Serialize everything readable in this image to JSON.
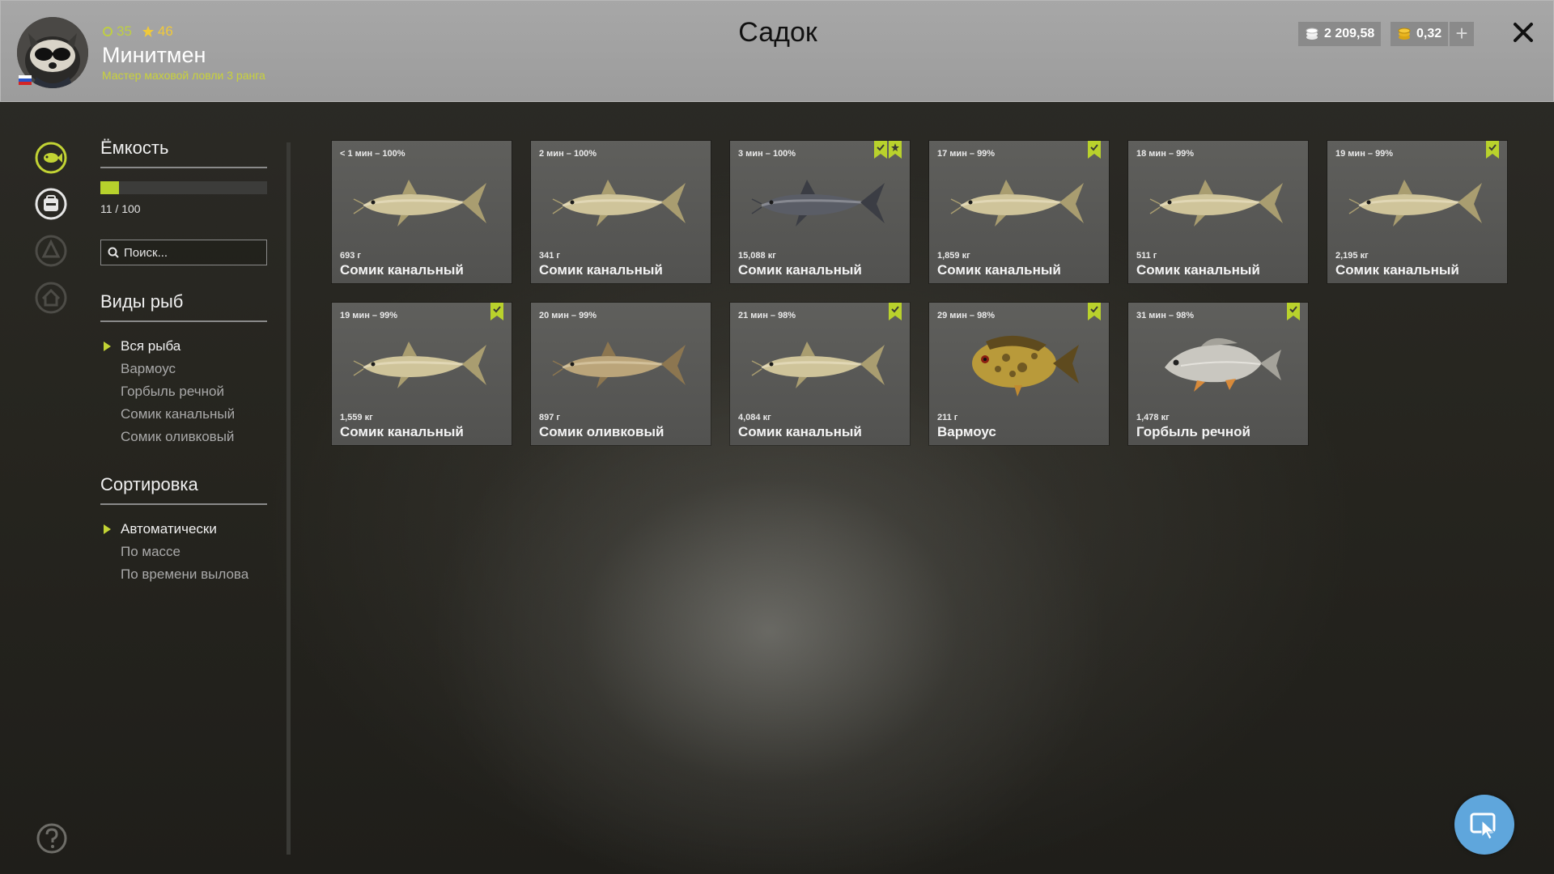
{
  "header": {
    "title": "Садок",
    "player": {
      "level": "35",
      "stars": "46",
      "name": "Минитмен",
      "rank": "Мастер маховой ловли 3 ранга"
    },
    "silver": "2 209,58",
    "gold": "0,32",
    "plus_label": "+"
  },
  "panel": {
    "capacity_heading": "Ёмкость",
    "capacity_text": "11 / 100",
    "capacity_fraction": 0.11,
    "search_placeholder": "Поиск...",
    "species_heading": "Виды рыб",
    "species": [
      "Вся рыба",
      "Вармоус",
      "Горбыль речной",
      "Сомик канальный",
      "Сомик оливковый"
    ],
    "sort_heading": "Сортировка",
    "sort": [
      "Автоматически",
      "По массе",
      "По времени вылова"
    ]
  },
  "fish": [
    {
      "time": "< 1 мин – 100%",
      "weight": "693 г",
      "name": "Сомик канальный",
      "kind": "catfish",
      "badges": 0
    },
    {
      "time": "2 мин – 100%",
      "weight": "341 г",
      "name": "Сомик канальный",
      "kind": "catfish",
      "badges": 0
    },
    {
      "time": "3 мин – 100%",
      "weight": "15,088 кг",
      "name": "Сомик канальный",
      "kind": "catfish-dark",
      "badges": 2
    },
    {
      "time": "17 мин – 99%",
      "weight": "1,859 кг",
      "name": "Сомик канальный",
      "kind": "catfish",
      "badges": 1
    },
    {
      "time": "18 мин – 99%",
      "weight": "511 г",
      "name": "Сомик канальный",
      "kind": "catfish",
      "badges": 0
    },
    {
      "time": "19 мин – 99%",
      "weight": "2,195 кг",
      "name": "Сомик канальный",
      "kind": "catfish",
      "badges": 1
    },
    {
      "time": "19 мин – 99%",
      "weight": "1,559 кг",
      "name": "Сомик канальный",
      "kind": "catfish",
      "badges": 1
    },
    {
      "time": "20 мин – 99%",
      "weight": "897 г",
      "name": "Сомик оливковый",
      "kind": "flathead",
      "badges": 0
    },
    {
      "time": "21 мин – 98%",
      "weight": "4,084 кг",
      "name": "Сомик канальный",
      "kind": "catfish",
      "badges": 1
    },
    {
      "time": "29 мин – 98%",
      "weight": "211 г",
      "name": "Вармоус",
      "kind": "warmouth",
      "badges": 1
    },
    {
      "time": "31 мин – 98%",
      "weight": "1,478 кг",
      "name": "Горбыль речной",
      "kind": "drum",
      "badges": 1
    }
  ],
  "colors": {
    "accent": "#c2d334",
    "badge": "#b9d22c",
    "chat": "#5fa6dc"
  }
}
